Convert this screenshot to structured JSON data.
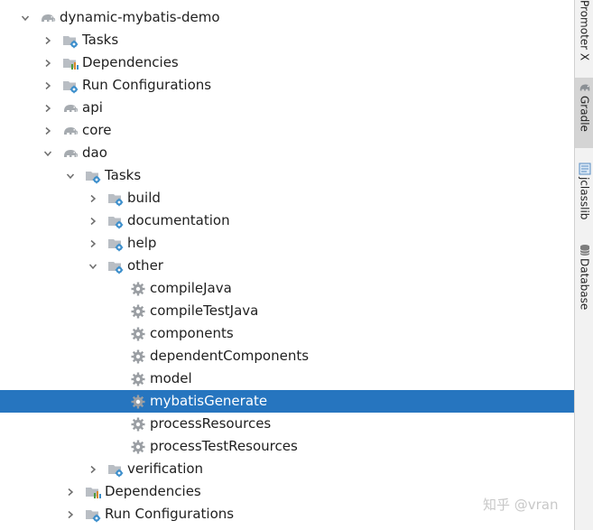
{
  "tree": [
    {
      "label": "dynamic-mybatis-demo",
      "level": 0,
      "expanded": true,
      "icon": "elephant-icon"
    },
    {
      "label": "Tasks",
      "level": 1,
      "expanded": false,
      "icon": "folder-gear-icon"
    },
    {
      "label": "Dependencies",
      "level": 1,
      "expanded": false,
      "icon": "folder-chart-icon"
    },
    {
      "label": "Run Configurations",
      "level": 1,
      "expanded": false,
      "icon": "folder-gear-icon"
    },
    {
      "label": "api",
      "level": 1,
      "expanded": false,
      "icon": "elephant-icon"
    },
    {
      "label": "core",
      "level": 1,
      "expanded": false,
      "icon": "elephant-icon"
    },
    {
      "label": "dao",
      "level": 1,
      "expanded": true,
      "icon": "elephant-icon"
    },
    {
      "label": "Tasks",
      "level": 2,
      "expanded": true,
      "icon": "folder-gear-icon"
    },
    {
      "label": "build",
      "level": 3,
      "expanded": false,
      "icon": "folder-gear-icon"
    },
    {
      "label": "documentation",
      "level": 3,
      "expanded": false,
      "icon": "folder-gear-icon"
    },
    {
      "label": "help",
      "level": 3,
      "expanded": false,
      "icon": "folder-gear-icon"
    },
    {
      "label": "other",
      "level": 3,
      "expanded": true,
      "icon": "folder-gear-icon"
    },
    {
      "label": "compileJava",
      "level": 4,
      "leaf": true,
      "icon": "gear-icon"
    },
    {
      "label": "compileTestJava",
      "level": 4,
      "leaf": true,
      "icon": "gear-icon"
    },
    {
      "label": "components",
      "level": 4,
      "leaf": true,
      "icon": "gear-icon"
    },
    {
      "label": "dependentComponents",
      "level": 4,
      "leaf": true,
      "icon": "gear-icon"
    },
    {
      "label": "model",
      "level": 4,
      "leaf": true,
      "icon": "gear-icon"
    },
    {
      "label": "mybatisGenerate",
      "level": 4,
      "leaf": true,
      "icon": "gear-icon",
      "selected": true
    },
    {
      "label": "processResources",
      "level": 4,
      "leaf": true,
      "icon": "gear-icon"
    },
    {
      "label": "processTestResources",
      "level": 4,
      "leaf": true,
      "icon": "gear-icon"
    },
    {
      "label": "verification",
      "level": 3,
      "expanded": false,
      "icon": "folder-gear-icon"
    },
    {
      "label": "Dependencies",
      "level": 2,
      "expanded": false,
      "icon": "folder-chart-icon"
    },
    {
      "label": "Run Configurations",
      "level": 2,
      "expanded": false,
      "icon": "folder-gear-icon"
    }
  ],
  "side_tabs": [
    {
      "label": "Promoter X",
      "icon": "",
      "active": false
    },
    {
      "label": "Gradle",
      "icon": "elephant-icon",
      "active": true
    },
    {
      "label": "jclasslib",
      "icon": "jclasslib-icon",
      "active": false
    },
    {
      "label": "Database",
      "icon": "database-icon",
      "active": false
    }
  ],
  "watermark": "知乎 @vran",
  "colors": {
    "selected": "#2675bf",
    "folder": "#b9bec4",
    "gear": "#3d8fcc",
    "elephant": "#a6abb0"
  }
}
